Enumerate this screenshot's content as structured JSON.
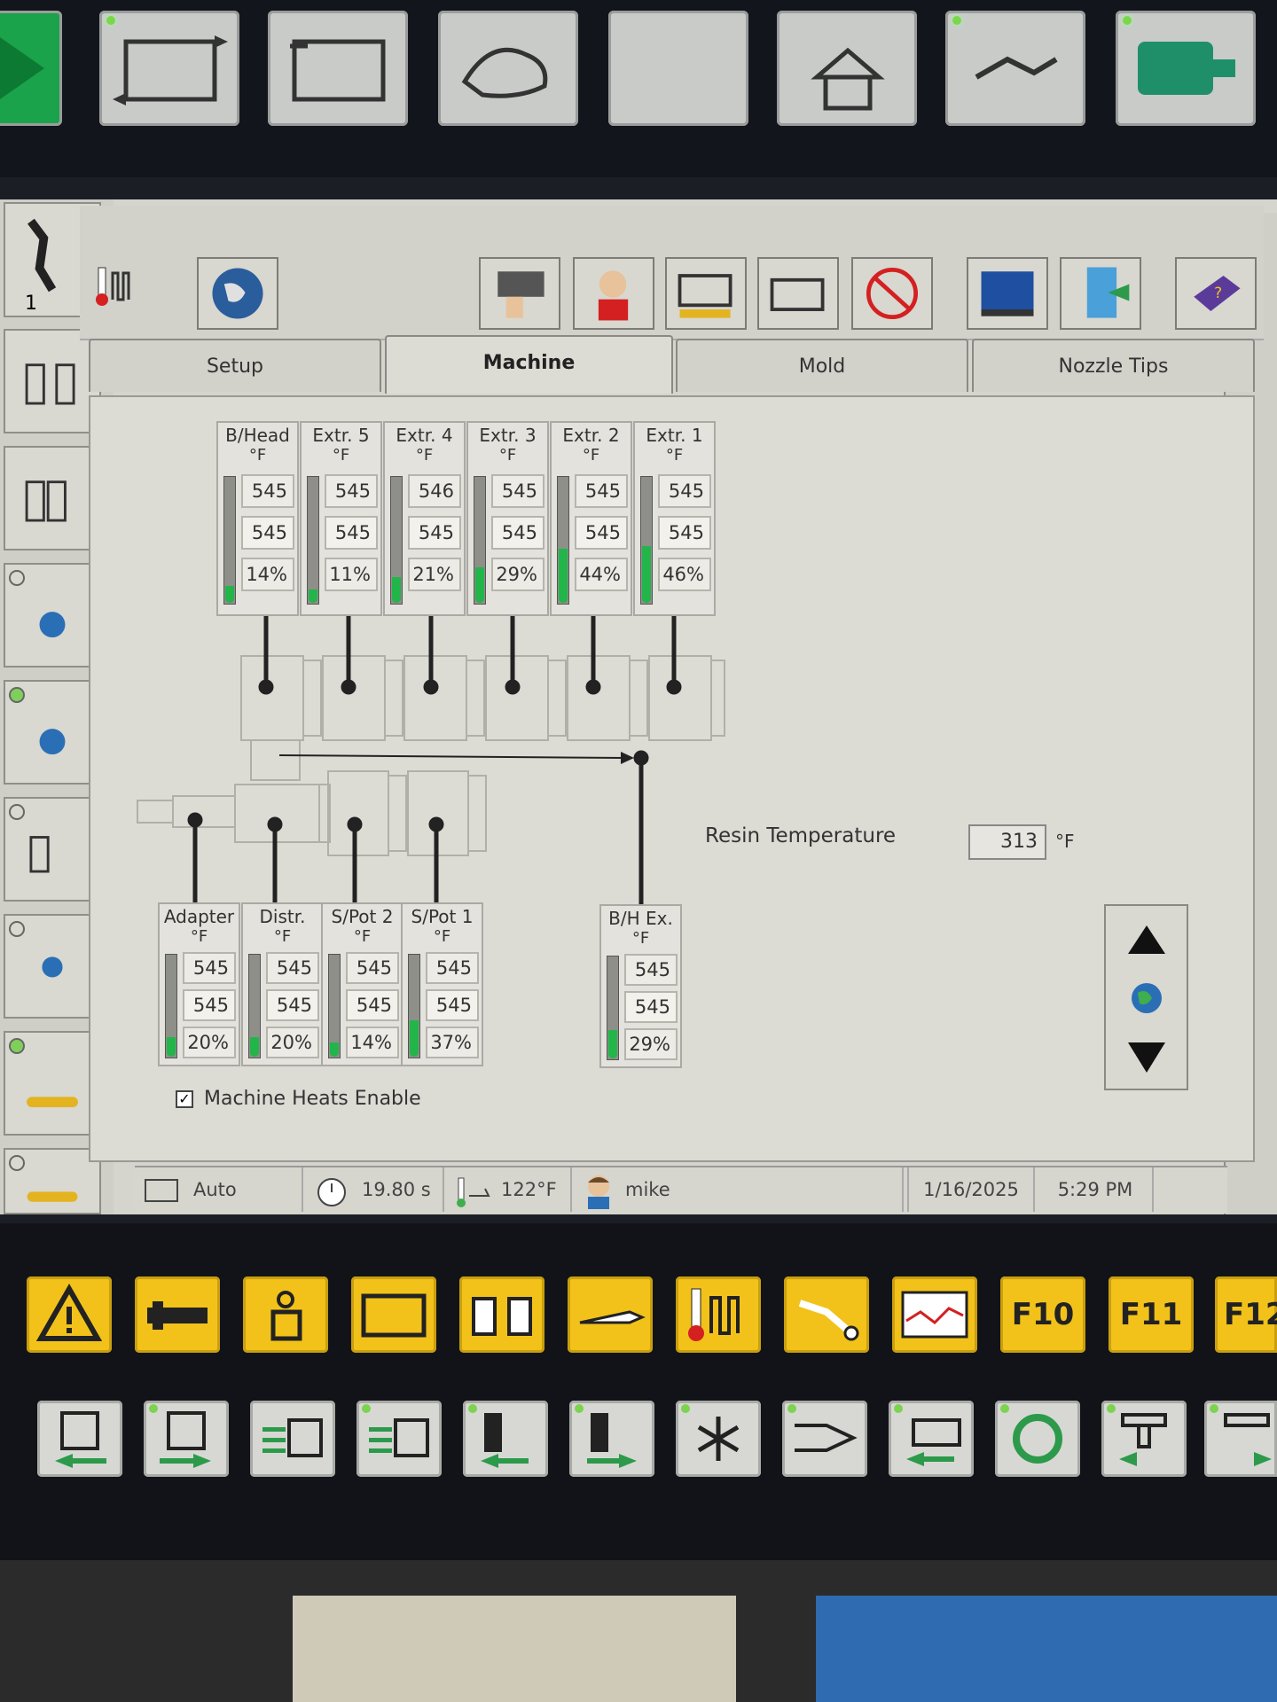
{
  "toolbar": {
    "user_level": "1"
  },
  "tabs": [
    {
      "label": "Setup"
    },
    {
      "label": "Machine"
    },
    {
      "label": "Mold"
    },
    {
      "label": "Nozzle Tips"
    }
  ],
  "zones_top": [
    {
      "name": "B/Head",
      "unit": "°F",
      "setpoint": "545",
      "actual": "545",
      "output": "14%",
      "fill": 0.14
    },
    {
      "name": "Extr. 5",
      "unit": "°F",
      "setpoint": "545",
      "actual": "545",
      "output": "11%",
      "fill": 0.11
    },
    {
      "name": "Extr. 4",
      "unit": "°F",
      "setpoint": "546",
      "actual": "545",
      "output": "21%",
      "fill": 0.21
    },
    {
      "name": "Extr. 3",
      "unit": "°F",
      "setpoint": "545",
      "actual": "545",
      "output": "29%",
      "fill": 0.29
    },
    {
      "name": "Extr. 2",
      "unit": "°F",
      "setpoint": "545",
      "actual": "545",
      "output": "44%",
      "fill": 0.44
    },
    {
      "name": "Extr. 1",
      "unit": "°F",
      "setpoint": "545",
      "actual": "545",
      "output": "46%",
      "fill": 0.46
    }
  ],
  "zones_bottom": [
    {
      "name": "Adapter",
      "unit": "°F",
      "setpoint": "545",
      "actual": "545",
      "output": "20%",
      "fill": 0.2
    },
    {
      "name": "Distr.",
      "unit": "°F",
      "setpoint": "545",
      "actual": "545",
      "output": "20%",
      "fill": 0.2
    },
    {
      "name": "S/Pot 2",
      "unit": "°F",
      "setpoint": "545",
      "actual": "545",
      "output": "14%",
      "fill": 0.14
    },
    {
      "name": "S/Pot 1",
      "unit": "°F",
      "setpoint": "545",
      "actual": "545",
      "output": "37%",
      "fill": 0.37
    }
  ],
  "zone_bh_ex": {
    "name": "B/H Ex.",
    "unit": "°F",
    "setpoint": "545",
    "actual": "545",
    "output": "29%",
    "fill": 0.29
  },
  "resin": {
    "label": "Resin Temperature",
    "value": "313",
    "unit": "°F"
  },
  "heats_enable": {
    "label": "Machine Heats Enable",
    "checked": true
  },
  "status": {
    "mode": "Auto",
    "cycle_time": "19.80 s",
    "oil_temp": "122°F",
    "user": "mike",
    "date": "1/16/2025",
    "time": "5:29 PM"
  },
  "function_keys": [
    "F10",
    "F11",
    "F12"
  ],
  "colors": {
    "heater_bar": "#22b54a",
    "function_key": "#f2c21a",
    "led_on": "#7bd34f"
  }
}
